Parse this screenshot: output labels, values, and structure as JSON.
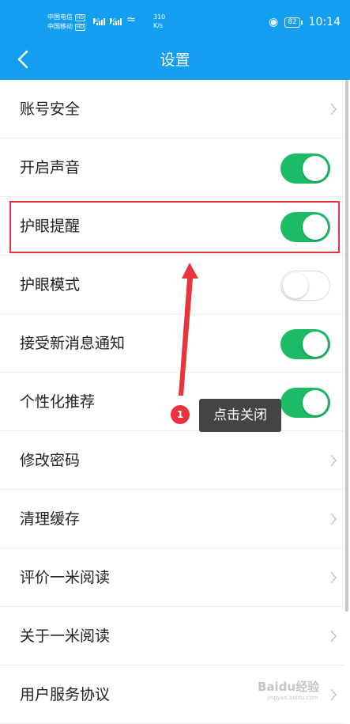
{
  "status_bar": {
    "carrier1": "中国电信",
    "carrier2": "中国移动",
    "hd_label": "HD",
    "network": "4G",
    "speed_value": "310",
    "speed_unit": "K/s",
    "battery": "82",
    "time": "10:14"
  },
  "header": {
    "title": "设置",
    "back_icon": "chevron-left-icon"
  },
  "settings": [
    {
      "label": "账号安全",
      "type": "link"
    },
    {
      "label": "开启声音",
      "type": "toggle",
      "on": true
    },
    {
      "label": "护眼提醒",
      "type": "toggle",
      "on": true
    },
    {
      "label": "护眼模式",
      "type": "toggle",
      "on": false
    },
    {
      "label": "接受新消息通知",
      "type": "toggle",
      "on": true
    },
    {
      "label": "个性化推荐",
      "type": "toggle",
      "on": true
    },
    {
      "label": "修改密码",
      "type": "link"
    },
    {
      "label": "清理缓存",
      "type": "link"
    },
    {
      "label": "评价一米阅读",
      "type": "link"
    },
    {
      "label": "关于一米阅读",
      "type": "link"
    },
    {
      "label": "用户服务协议",
      "type": "link"
    }
  ],
  "annotation": {
    "step_number": "1",
    "tooltip": "点击关闭"
  },
  "watermark": {
    "text": "Baidu经验",
    "url": "jingyan.baidu.com"
  },
  "colors": {
    "header": "#139ef0",
    "toggle_on": "#1cbc67",
    "highlight": "#e8343c",
    "tooltip_bg": "#444444"
  }
}
